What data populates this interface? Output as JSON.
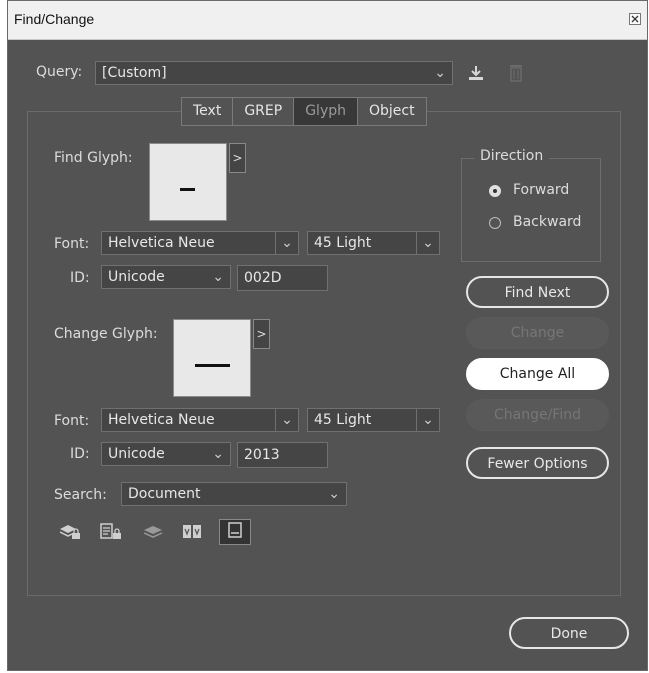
{
  "window": {
    "title": "Find/Change"
  },
  "query": {
    "label": "Query:",
    "value": "[Custom]"
  },
  "tabs": [
    {
      "label": "Text",
      "active": false
    },
    {
      "label": "GREP",
      "active": false
    },
    {
      "label": "Glyph",
      "active": true
    },
    {
      "label": "Object",
      "active": false
    }
  ],
  "find_glyph": {
    "label": "Find Glyph:",
    "font_label": "Font:",
    "font_family": "Helvetica Neue",
    "font_style": "45 Light",
    "id_label": "ID:",
    "id_type": "Unicode",
    "id_value": "002D"
  },
  "change_glyph": {
    "label": "Change Glyph:",
    "font_label": "Font:",
    "font_family": "Helvetica Neue",
    "font_style": "45 Light",
    "id_label": "ID:",
    "id_type": "Unicode",
    "id_value": "2013"
  },
  "search": {
    "label": "Search:",
    "value": "Document"
  },
  "direction": {
    "legend": "Direction",
    "options": [
      {
        "label": "Forward",
        "selected": true
      },
      {
        "label": "Backward",
        "selected": false
      }
    ]
  },
  "buttons": {
    "find_next": "Find Next",
    "change": "Change",
    "change_all": "Change All",
    "change_find": "Change/Find",
    "fewer_options": "Fewer Options",
    "done": "Done"
  },
  "icons": {
    "save_query": "save-query-icon",
    "delete_query": "trash-icon",
    "search_options": [
      "locked-layers-icon",
      "locked-stories-icon",
      "hidden-layers-icon",
      "master-pages-icon",
      "footnotes-icon"
    ]
  },
  "colors": {
    "panel_bg": "#535353",
    "field_bg": "#454545",
    "button_filled": "#ffffff"
  }
}
